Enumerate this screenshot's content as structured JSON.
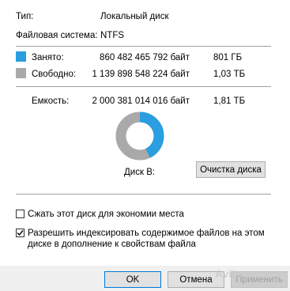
{
  "general": {
    "type_label": "Тип:",
    "type_value": "Локальный диск",
    "fs_label": "Файловая система:",
    "fs_value": "NTFS"
  },
  "usage": {
    "used": {
      "label": "Занято:",
      "bytes": "860 482 465 792 байт",
      "size": "801 ГБ",
      "color": "#2a9ee0"
    },
    "free": {
      "label": "Свободно:",
      "bytes": "1 139 898 548 224 байт",
      "size": "1,03 ТБ",
      "color": "#a9a9a9"
    },
    "capacity": {
      "label": "Емкость:",
      "bytes": "2 000 381 014 016 байт",
      "size": "1,81 ТБ"
    },
    "used_fraction": 0.43
  },
  "drive_label": "Диск B:",
  "cleanup_button": "Очистка диска",
  "options": {
    "compress": {
      "label": "Сжать этот диск для экономии места",
      "checked": false
    },
    "index": {
      "label_line1": "Разрешить индексировать содержимое файлов на этом",
      "label_line2": "диске в дополнение к свойствам файла",
      "checked": true
    }
  },
  "footer": {
    "ok": "OK",
    "cancel": "Отмена",
    "apply": "Применить"
  },
  "watermark": "Avito"
}
